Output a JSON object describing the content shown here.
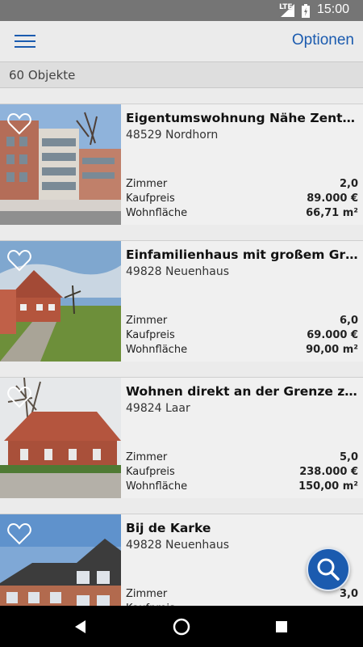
{
  "status_bar": {
    "network": "LTE",
    "time": "15:00"
  },
  "app_bar": {
    "options_label": "Optionen"
  },
  "results": {
    "count_label": "60 Objekte"
  },
  "labels": {
    "rooms": "Zimmer",
    "price": "Kaufpreis",
    "area": "Wohnfläche"
  },
  "listings": [
    {
      "title": "Eigentumswohnung Nähe Zentrum",
      "location": "48529 Nordhorn",
      "rooms": "2,0",
      "price": "89.000 €",
      "area": "66,71 m²"
    },
    {
      "title": "Einfamilienhaus mit großem Gru…",
      "location": "49828 Neuenhaus",
      "rooms": "6,0",
      "price": "69.000 €",
      "area": "90,00 m²"
    },
    {
      "title": "Wohnen direkt an der Grenze zu…",
      "location": "49824 Laar",
      "rooms": "5,0",
      "price": "238.000 €",
      "area": "150,00 m²"
    },
    {
      "title": "Bij de Karke",
      "location": "49828 Neuenhaus",
      "rooms": "3,0",
      "price": "",
      "area": ""
    }
  ],
  "colors": {
    "accent": "#1b5baf",
    "status_bar": "#757575",
    "nav_bar": "#000000"
  }
}
